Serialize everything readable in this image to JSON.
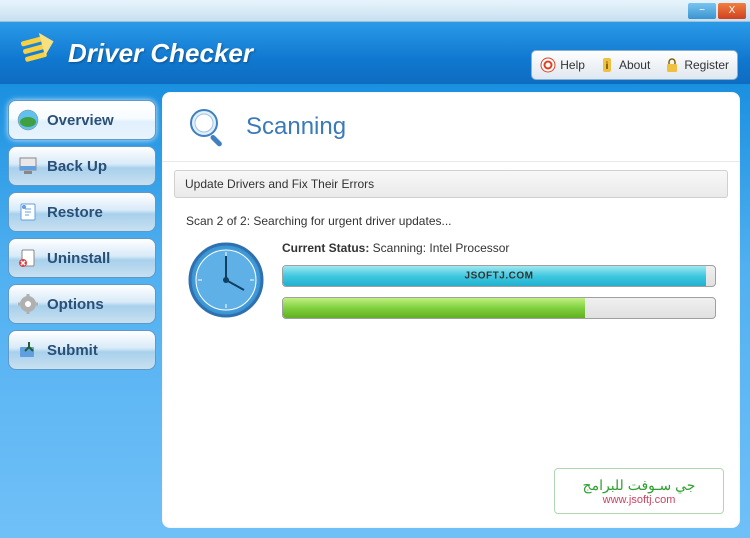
{
  "app": {
    "title": "Driver Checker"
  },
  "titlebar": {
    "minimize": "−",
    "close": "X"
  },
  "header_links": {
    "help": "Help",
    "about": "About",
    "register": "Register"
  },
  "sidebar": {
    "items": [
      {
        "label": "Overview",
        "active": true
      },
      {
        "label": "Back Up"
      },
      {
        "label": "Restore"
      },
      {
        "label": "Uninstall"
      },
      {
        "label": "Options"
      },
      {
        "label": "Submit"
      }
    ]
  },
  "content": {
    "title": "Scanning",
    "info_bar": "Update Drivers and Fix Their Errors",
    "scan_status": "Scan 2 of 2: Searching for urgent driver updates...",
    "current_status_label": "Current Status:",
    "current_status_value": " Scanning:  Intel Processor",
    "progress1": {
      "percent": 98,
      "label": "JSOFTJ.COM"
    },
    "progress2": {
      "percent": 70
    }
  },
  "watermark": {
    "ar": "جي سـوفت للبرامج",
    "url": "www.jsoftj.com"
  },
  "colors": {
    "accent_blue": "#1a90e0",
    "progress_cyan": "#40c8e0",
    "progress_green": "#80d040"
  }
}
